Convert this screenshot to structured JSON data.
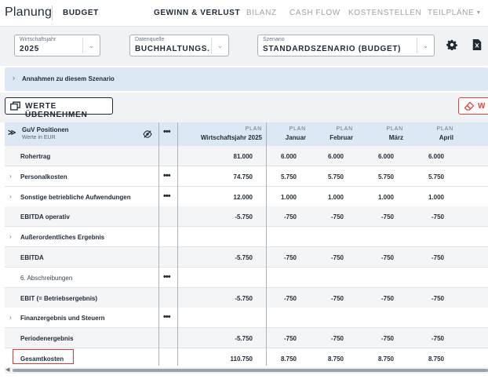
{
  "app": {
    "title": "Planung",
    "section": "BUDGET"
  },
  "nav": {
    "tabs": [
      {
        "label": "GEWINN & VERLUST",
        "active": true
      },
      {
        "label": "BILANZ",
        "active": false
      },
      {
        "label": "CASH FLOW",
        "active": false
      },
      {
        "label": "KOSTENSTELLEN",
        "active": false
      },
      {
        "label": "TEILPLÄNE",
        "active": false,
        "dropdown": true
      }
    ]
  },
  "filters": {
    "year": {
      "label": "Wirtschaftsjahr",
      "value": "2025"
    },
    "source": {
      "label": "Datenquelle",
      "value": "BUCHHALTUNGS..."
    },
    "scenario": {
      "label": "Szenario",
      "value": "STANDARDSZENARIO (BUDGET)"
    }
  },
  "assumptions": {
    "label": "Annahmen zu diesem Szenario"
  },
  "actions": {
    "take_values": "WERTE ÜBERNEHMEN",
    "red_button": "W"
  },
  "table": {
    "header": {
      "title": "GuV Positionen",
      "subtitle": "Werte in EUR",
      "more": "•••"
    },
    "columns": [
      {
        "tag": "PLAN",
        "name": "Wirtschaftsjahr 2025"
      },
      {
        "tag": "PLAN",
        "name": "Januar"
      },
      {
        "tag": "PLAN",
        "name": "Februar"
      },
      {
        "tag": "PLAN",
        "name": "März"
      },
      {
        "tag": "PLAN",
        "name": "April"
      }
    ],
    "rows": [
      {
        "label": "Rohertrag",
        "expand": false,
        "dots": false,
        "shade": true,
        "values": [
          "81.000",
          "6.000",
          "6.000",
          "6.000",
          "6.000"
        ]
      },
      {
        "label": "Personalkosten",
        "expand": true,
        "dots": true,
        "shade": false,
        "values": [
          "74.750",
          "5.750",
          "5.750",
          "5.750",
          "5.750"
        ]
      },
      {
        "label": "Sonstige betriebliche Aufwendungen",
        "expand": true,
        "dots": true,
        "shade": false,
        "values": [
          "12.000",
          "1.000",
          "1.000",
          "1.000",
          "1.000"
        ]
      },
      {
        "label": "EBITDA operativ",
        "expand": false,
        "dots": false,
        "shade": true,
        "values": [
          "-5.750",
          "-750",
          "-750",
          "-750",
          "-750"
        ]
      },
      {
        "label": "Außerordentliches Ergebnis",
        "expand": true,
        "dots": false,
        "shade": false,
        "values": [
          "",
          "",
          "",
          "",
          ""
        ]
      },
      {
        "label": "EBITDA",
        "expand": false,
        "dots": false,
        "shade": true,
        "values": [
          "-5.750",
          "-750",
          "-750",
          "-750",
          "-750"
        ]
      },
      {
        "label": "6. Abschreibungen",
        "expand": false,
        "dots": true,
        "shade": false,
        "light": true,
        "values": [
          "",
          "",
          "",
          "",
          ""
        ]
      },
      {
        "label": "EBIT (= Betriebsergebnis)",
        "expand": false,
        "dots": false,
        "shade": true,
        "values": [
          "-5.750",
          "-750",
          "-750",
          "-750",
          "-750"
        ]
      },
      {
        "label": "Finanzergebnis und Steuern",
        "expand": true,
        "dots": true,
        "shade": false,
        "values": [
          "",
          "",
          "",
          "",
          ""
        ]
      },
      {
        "label": "Periodenergebnis",
        "expand": false,
        "dots": false,
        "shade": true,
        "values": [
          "-5.750",
          "-750",
          "-750",
          "-750",
          "-750"
        ]
      },
      {
        "label": "Gesamtkosten",
        "expand": false,
        "dots": false,
        "shade": false,
        "values": [
          "110.750",
          "8.750",
          "8.750",
          "8.750",
          "8.750"
        ]
      }
    ]
  },
  "colors": {
    "accent": "#dce8f3",
    "danger": "#e0443c",
    "text": "#1f2a36"
  }
}
